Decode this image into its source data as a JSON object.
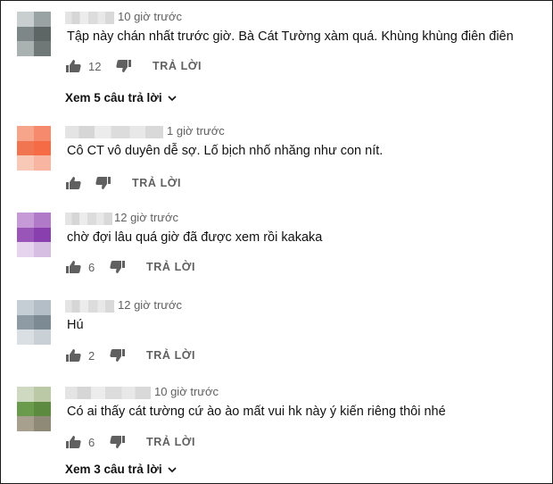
{
  "comments": [
    {
      "time": "10 giờ trước",
      "text": "Tập này chán nhất trước giờ. Bà Cát Tường xàm quá. Khùng khùng điên điên",
      "likes": "12",
      "reply_label": "TRẢ LỜI",
      "view_replies": "Xem 5 câu trả lời",
      "avatar_colors": [
        "#c9cfcf",
        "#9aa3a3",
        "#7e8787",
        "#5d6565",
        "#aab1b1",
        "#6f7777"
      ]
    },
    {
      "time": "1 giờ trước",
      "text": "Cô CT vô duyên dễ sợ. Lố bịch nhố nhăng như con nít.",
      "likes": "",
      "reply_label": "TRẢ LỜI",
      "avatar_colors": [
        "#f7a58a",
        "#f58a6c",
        "#f27552",
        "#f46b45",
        "#f9c9b8",
        "#f8b6a2"
      ]
    },
    {
      "time": "12 giờ trước",
      "text": "chờ đợi lâu quá giờ đã được xem rồi kakaka",
      "likes": "6",
      "reply_label": "TRẢ LỜI",
      "avatar_colors": [
        "#c59ad6",
        "#b07ac8",
        "#9a55b8",
        "#8a3fae",
        "#e6d3ee",
        "#d6bde2"
      ]
    },
    {
      "time": "12 giờ trước",
      "text": "Hú",
      "likes": "2",
      "reply_label": "TRẢ LỜI",
      "avatar_colors": [
        "#c5ced4",
        "#b3bec6",
        "#8e9ba4",
        "#7c8a94",
        "#d9dfe3",
        "#c9d1d6"
      ]
    },
    {
      "time": "10 giờ trước",
      "text": "Có ai thấy cát tường cứ ào ào mất vui hk này ý kiến riêng thôi nhé",
      "likes": "6",
      "reply_label": "TRẢ LỜI",
      "view_replies": "Xem 3 câu trả lời",
      "avatar_colors": [
        "#cfd8c0",
        "#bcc9a6",
        "#6a9a4c",
        "#5c8a3e",
        "#a7a08e",
        "#8f8a78"
      ]
    }
  ]
}
